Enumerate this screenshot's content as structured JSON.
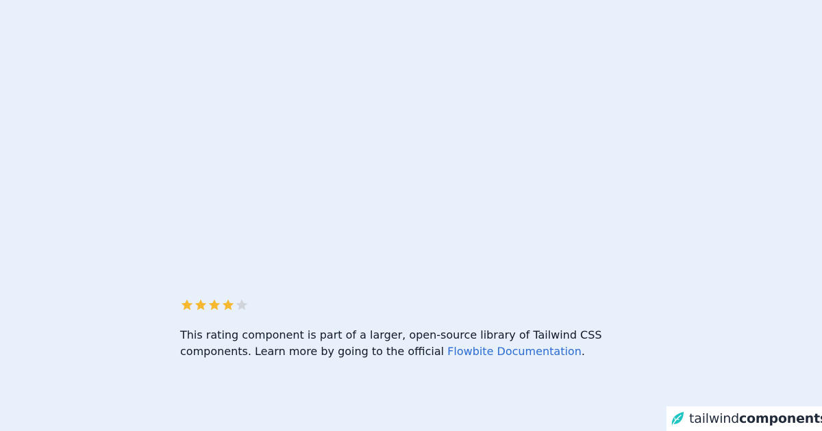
{
  "rating": {
    "value": 4,
    "max": 5,
    "filled_color": "#f5b82e",
    "empty_color": "#d1d5db",
    "icon": "star-icon"
  },
  "description": {
    "text_before_link": "This rating component is part of a larger, open-source library of Tailwind CSS components. Learn more by going to the official ",
    "link_text": "Flowbite Documentation",
    "text_after_link": ".",
    "link_color": "#2b6bd3"
  },
  "brand": {
    "name_light": "tailwind",
    "name_bold": "components",
    "icon": "leaf-logo-icon",
    "icon_color": "#1fc6c1"
  }
}
